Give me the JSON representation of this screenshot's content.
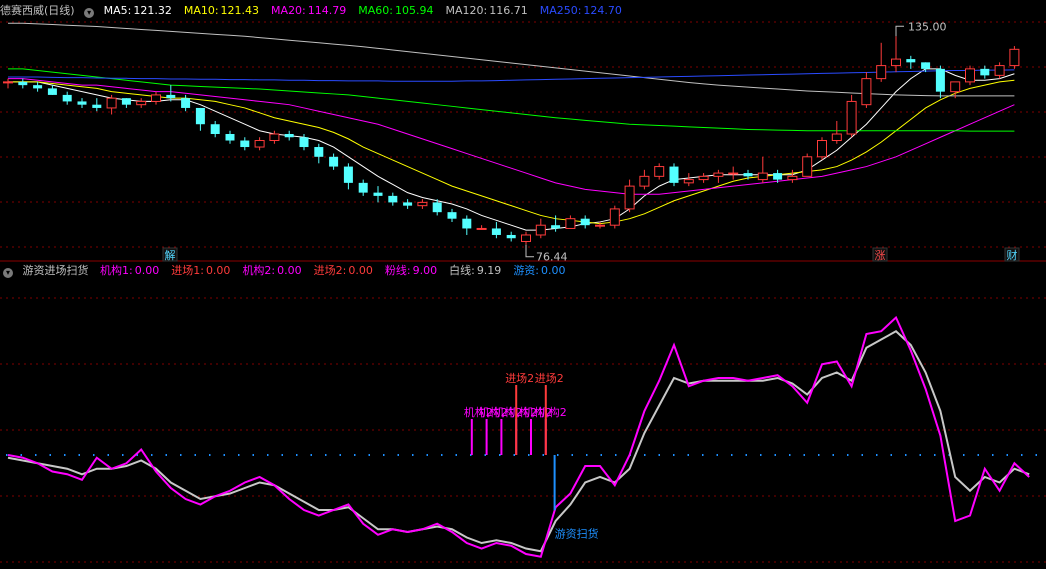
{
  "colors": {
    "ma5": "#ffffff",
    "ma10": "#ffff00",
    "ma20": "#ff00ff",
    "ma60": "#00ff00",
    "ma120": "#c0c0c0",
    "ma250": "#2a4bff",
    "up": "#ff3b3b",
    "down": "#54ffff",
    "fen": "#ff00ff",
    "bai": "#c8c8c8",
    "youzi": "#1e90ff",
    "grid": "#800000",
    "text": "#c0c0c0"
  },
  "main": {
    "title": "德赛西威(日线)",
    "ma": [
      {
        "label": "MA5:",
        "value": "121.32",
        "color": "#ffffff"
      },
      {
        "label": "MA10:",
        "value": "121.43",
        "color": "#ffff00"
      },
      {
        "label": "MA20:",
        "value": "114.79",
        "color": "#ff00ff"
      },
      {
        "label": "MA60:",
        "value": "105.94",
        "color": "#00ff00"
      },
      {
        "label": "MA120:",
        "value": "116.71",
        "color": "#c0c0c0"
      },
      {
        "label": "MA250:",
        "value": "124.70",
        "color": "#2a4bff"
      }
    ],
    "high_label": "135.00",
    "low_label": "76.44",
    "badges": [
      "解",
      "涨",
      "财"
    ]
  },
  "sub": {
    "title": "游资进场扫货",
    "indicators": [
      {
        "label": "机构1:",
        "value": "0.00",
        "color": "#ff00ff"
      },
      {
        "label": "进场1:",
        "value": "0.00",
        "color": "#ff3b3b"
      },
      {
        "label": "机构2:",
        "value": "0.00",
        "color": "#ff00ff"
      },
      {
        "label": "进场2:",
        "value": "0.00",
        "color": "#ff3b3b"
      },
      {
        "label": "粉线:",
        "value": "9.00",
        "color": "#ff00ff"
      },
      {
        "label": "白线:",
        "value": "9.19",
        "color": "#c0c0c0"
      },
      {
        "label": "游资:",
        "value": "0.00",
        "color": "#1e90ff"
      }
    ],
    "signal_labels": {
      "jigou": "机构2",
      "jinchang": "进场2",
      "youzi": "游资扫货"
    }
  },
  "chart_data": {
    "type": "candlestick",
    "price_range": [
      70,
      140
    ],
    "candles": [
      [
        121,
        122,
        119,
        121
      ],
      [
        121,
        122,
        119,
        120
      ],
      [
        120,
        121,
        118,
        119
      ],
      [
        119,
        120,
        117,
        117
      ],
      [
        117,
        118,
        114,
        115
      ],
      [
        115,
        116,
        113,
        114
      ],
      [
        114,
        116,
        112,
        113
      ],
      [
        113,
        117,
        111,
        116
      ],
      [
        116,
        116,
        113,
        114
      ],
      [
        114,
        116,
        113,
        115
      ],
      [
        115,
        118,
        114,
        117
      ],
      [
        117,
        120,
        115,
        116
      ],
      [
        116,
        117,
        112,
        113
      ],
      [
        113,
        113,
        106,
        108
      ],
      [
        108,
        109,
        104,
        105
      ],
      [
        105,
        106,
        102,
        103
      ],
      [
        103,
        104,
        100,
        101
      ],
      [
        101,
        104,
        100,
        103
      ],
      [
        103,
        106,
        102,
        105
      ],
      [
        105,
        106,
        103,
        104
      ],
      [
        104,
        105,
        100,
        101
      ],
      [
        101,
        102,
        96,
        98
      ],
      [
        98,
        99,
        94,
        95
      ],
      [
        95,
        96,
        88,
        90
      ],
      [
        90,
        91,
        86,
        87
      ],
      [
        87,
        89,
        84,
        86
      ],
      [
        86,
        87,
        83,
        84
      ],
      [
        84,
        85,
        82,
        83
      ],
      [
        83,
        85,
        82,
        84
      ],
      [
        84,
        85,
        80,
        81
      ],
      [
        81,
        82,
        78,
        79
      ],
      [
        79,
        80,
        74,
        76
      ],
      [
        76,
        77,
        76,
        76
      ],
      [
        76,
        78,
        73,
        74
      ],
      [
        74,
        75,
        72,
        73
      ],
      [
        72,
        75,
        71,
        74
      ],
      [
        74,
        79,
        73,
        77
      ],
      [
        77,
        80,
        75,
        76
      ],
      [
        76,
        80,
        76,
        79
      ],
      [
        79,
        80,
        76,
        77
      ],
      [
        77,
        78,
        76,
        77
      ],
      [
        77,
        83,
        76,
        82
      ],
      [
        82,
        91,
        81,
        89
      ],
      [
        89,
        94,
        88,
        92
      ],
      [
        92,
        96,
        91,
        95
      ],
      [
        95,
        96,
        89,
        90
      ],
      [
        90,
        93,
        89,
        91
      ],
      [
        91,
        93,
        90,
        92
      ],
      [
        92,
        94,
        90,
        93
      ],
      [
        93,
        95,
        91,
        93
      ],
      [
        93,
        94,
        91,
        92
      ],
      [
        91,
        98,
        90,
        93
      ],
      [
        93,
        94,
        90,
        91
      ],
      [
        91,
        94,
        90,
        92
      ],
      [
        92,
        99,
        92,
        98
      ],
      [
        98,
        104,
        97,
        103
      ],
      [
        103,
        109,
        102,
        105
      ],
      [
        105,
        117,
        104,
        115
      ],
      [
        114,
        124,
        113,
        122
      ],
      [
        122,
        133,
        121,
        126
      ],
      [
        126,
        135,
        124,
        128
      ],
      [
        128,
        129,
        125,
        127
      ],
      [
        127,
        127,
        124,
        125
      ],
      [
        125,
        126,
        116,
        118
      ],
      [
        118,
        121,
        116,
        121
      ],
      [
        121,
        126,
        120,
        125
      ],
      [
        125,
        126,
        122,
        123
      ],
      [
        123,
        127,
        122,
        126
      ],
      [
        126,
        132,
        125,
        131
      ]
    ],
    "ma_series": {
      "MA5": [
        121,
        121,
        121,
        120,
        119,
        118,
        117,
        116,
        115.5,
        115,
        115,
        115.5,
        115.5,
        114,
        112,
        110,
        108,
        106,
        105,
        104.5,
        104,
        103,
        101,
        98,
        95,
        92,
        89.5,
        87,
        85.5,
        84.5,
        83.5,
        82,
        80,
        78.5,
        77,
        75.5,
        75.5,
        76,
        76.5,
        77.5,
        78,
        79,
        82,
        86,
        89,
        91,
        91.5,
        92,
        92.5,
        92.5,
        92.5,
        92.5,
        92.5,
        92.5,
        94,
        97,
        100,
        104,
        108,
        113,
        118,
        122,
        125,
        125,
        123,
        121.5,
        121.5,
        122,
        123.5
      ],
      "MA10": [
        121,
        121,
        121,
        120.5,
        120,
        119.5,
        119,
        118,
        117.5,
        117,
        116.5,
        116,
        116,
        115.5,
        115,
        114,
        113,
        111.5,
        110,
        109,
        108,
        107,
        105.5,
        103.5,
        101,
        99,
        97,
        95,
        93,
        91,
        89,
        87.5,
        86,
        84.5,
        83,
        81.5,
        80,
        79,
        78.5,
        78,
        77.5,
        78,
        79,
        80.5,
        82.5,
        84.5,
        86,
        87.5,
        89,
        90.5,
        91.5,
        92,
        92.5,
        93,
        93.5,
        94,
        95,
        97,
        99.5,
        102.5,
        106,
        109.5,
        113,
        115.5,
        117.5,
        119,
        120,
        121,
        121.5
      ],
      "MA20": [
        122,
        122,
        121.5,
        121,
        120.5,
        120,
        120,
        119.5,
        119,
        118.5,
        118,
        118,
        117.5,
        117,
        116.5,
        116,
        115.5,
        115,
        114.5,
        114,
        113,
        112,
        111,
        110,
        109,
        108,
        106.5,
        105,
        103.5,
        102,
        100.5,
        99,
        97.5,
        96,
        94.5,
        93,
        91.5,
        90,
        89,
        88,
        87.5,
        87,
        86.5,
        86.5,
        86.5,
        87,
        87.5,
        88,
        88.5,
        89,
        89.5,
        90,
        90.5,
        91,
        91.5,
        92,
        93,
        94,
        95,
        96.5,
        98,
        100,
        102,
        104,
        106,
        108,
        110,
        112,
        114
      ],
      "MA60": [
        125,
        125,
        124.5,
        124,
        123.5,
        123,
        122.5,
        122,
        121.5,
        121,
        120.5,
        120,
        119.8,
        119.6,
        119.4,
        119.2,
        119,
        118.8,
        118.5,
        118.2,
        117.9,
        117.6,
        117.3,
        117,
        116.5,
        116,
        115.5,
        115,
        114.5,
        114,
        113.5,
        113,
        112.5,
        112,
        111.5,
        111,
        110.5,
        110,
        109.6,
        109.2,
        108.8,
        108.4,
        108,
        107.8,
        107.6,
        107.4,
        107.2,
        107,
        106.8,
        106.6,
        106.4,
        106.3,
        106.2,
        106.1,
        106,
        106,
        106,
        106,
        106,
        106,
        106,
        106,
        106,
        106,
        106,
        105.9,
        105.9,
        105.9,
        105.9
      ],
      "MA120": [
        139,
        139,
        138.8,
        138.6,
        138.4,
        138.2,
        138,
        137.7,
        137.4,
        137.1,
        136.8,
        136.5,
        136.2,
        135.9,
        135.6,
        135.3,
        135,
        134.6,
        134.2,
        133.8,
        133.4,
        133,
        132.6,
        132.2,
        131.8,
        131.3,
        130.8,
        130.3,
        129.8,
        129.3,
        128.8,
        128.3,
        127.8,
        127.3,
        126.8,
        126.3,
        125.8,
        125.3,
        124.8,
        124.3,
        123.8,
        123.3,
        122.8,
        122.3,
        121.8,
        121.3,
        120.8,
        120.4,
        120,
        119.7,
        119.4,
        119.1,
        118.8,
        118.5,
        118.2,
        118,
        117.8,
        117.6,
        117.4,
        117.2,
        117,
        116.9,
        116.8,
        116.7,
        116.7,
        116.7,
        116.7,
        116.7,
        116.7
      ],
      "MA250": [
        122.5,
        122.5,
        122.5,
        122.4,
        122.3,
        122.3,
        122.2,
        122.1,
        122.1,
        122,
        122,
        121.9,
        121.9,
        121.8,
        121.8,
        121.7,
        121.7,
        121.6,
        121.6,
        121.5,
        121.5,
        121.4,
        121.4,
        121.3,
        121.3,
        121.3,
        121.2,
        121.2,
        121.2,
        121.2,
        121.2,
        121.3,
        121.3,
        121.4,
        121.5,
        121.6,
        121.7,
        121.8,
        121.9,
        122,
        122.1,
        122.2,
        122.3,
        122.4,
        122.5,
        122.6,
        122.7,
        122.8,
        122.9,
        123,
        123.1,
        123.2,
        123.3,
        123.4,
        123.5,
        123.6,
        123.7,
        123.8,
        123.9,
        124,
        124.1,
        124.2,
        124.3,
        124.4,
        124.5,
        124.5,
        124.6,
        124.6,
        124.7
      ]
    },
    "sub_range": [
      0,
      100
    ],
    "fen": [
      40,
      39,
      37,
      34,
      33,
      31,
      39,
      35,
      37,
      42,
      34,
      28,
      24,
      22,
      25,
      27,
      30,
      32,
      29,
      24,
      20,
      18,
      20,
      22,
      15,
      11,
      13,
      12,
      13,
      15,
      12,
      8,
      6,
      8,
      7,
      4,
      3,
      21,
      26,
      36,
      36,
      29,
      40,
      56,
      67,
      80,
      65,
      67,
      68,
      68,
      67,
      68,
      69,
      65,
      59,
      73,
      74,
      65,
      84,
      85,
      90,
      78,
      64,
      47,
      16,
      18,
      35,
      27,
      37,
      32
    ],
    "bai": [
      39,
      38,
      37,
      36,
      35,
      33,
      35,
      35,
      36,
      38,
      35,
      30,
      27,
      24,
      25,
      26,
      28,
      30,
      29,
      26,
      23,
      20,
      20,
      21,
      17,
      13,
      13,
      12,
      13,
      14,
      13,
      10,
      8,
      9,
      8,
      6,
      5,
      16,
      22,
      30,
      32,
      30,
      35,
      48,
      58,
      68,
      66,
      67,
      67,
      67,
      67,
      67,
      68,
      66,
      62,
      68,
      70,
      67,
      79,
      82,
      85,
      80,
      70,
      56,
      32,
      27,
      32,
      30,
      35,
      33
    ],
    "marks": {
      "jigou_index": [
        31,
        32,
        33,
        34,
        35,
        36
      ],
      "jinchang_index": [
        34,
        36
      ],
      "youzi_index": 37,
      "baseline": 40
    }
  }
}
